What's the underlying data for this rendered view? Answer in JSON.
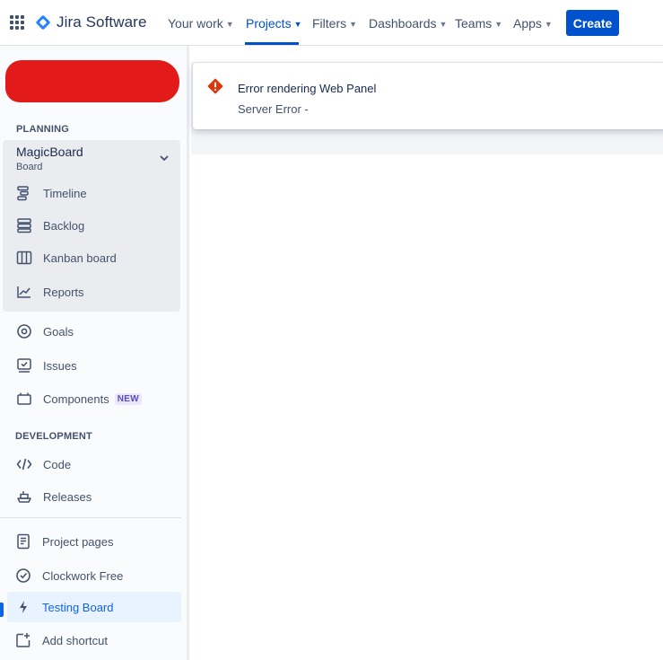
{
  "topnav": {
    "product": "Jira Software",
    "items": [
      {
        "label": "Your work",
        "active": false
      },
      {
        "label": "Projects",
        "active": true
      },
      {
        "label": "Filters",
        "active": false
      },
      {
        "label": "Dashboards",
        "active": false
      },
      {
        "label": "Teams",
        "active": false
      },
      {
        "label": "Apps",
        "active": false
      }
    ],
    "create_label": "Create",
    "accent_color": "#0052cc"
  },
  "sidebar": {
    "planning_heading": "PLANNING",
    "board": {
      "name": "MagicBoard",
      "type": "Board"
    },
    "board_items": [
      {
        "label": "Timeline",
        "icon": "timeline-icon"
      },
      {
        "label": "Backlog",
        "icon": "backlog-icon"
      },
      {
        "label": "Kanban board",
        "icon": "kanban-board-icon"
      },
      {
        "label": "Reports",
        "icon": "reports-icon"
      }
    ],
    "planning_items": [
      {
        "label": "Goals",
        "icon": "goals-icon"
      },
      {
        "label": "Issues",
        "icon": "issues-icon"
      },
      {
        "label": "Components",
        "icon": "components-icon",
        "badge": "NEW"
      }
    ],
    "development_heading": "DEVELOPMENT",
    "development_items": [
      {
        "label": "Code",
        "icon": "code-icon"
      },
      {
        "label": "Releases",
        "icon": "releases-icon"
      }
    ],
    "shortcut_items": [
      {
        "label": "Project pages",
        "icon": "project-pages-icon"
      },
      {
        "label": "Clockwork Free",
        "icon": "clock-icon"
      },
      {
        "label": "Testing Board",
        "icon": "lightning-icon",
        "selected": true
      },
      {
        "label": "Add shortcut",
        "icon": "add-shortcut-icon"
      }
    ]
  },
  "error_panel": {
    "title": "Error rendering Web Panel",
    "message": "Server Error -",
    "icon": "error-icon",
    "icon_color": "#de350b"
  }
}
